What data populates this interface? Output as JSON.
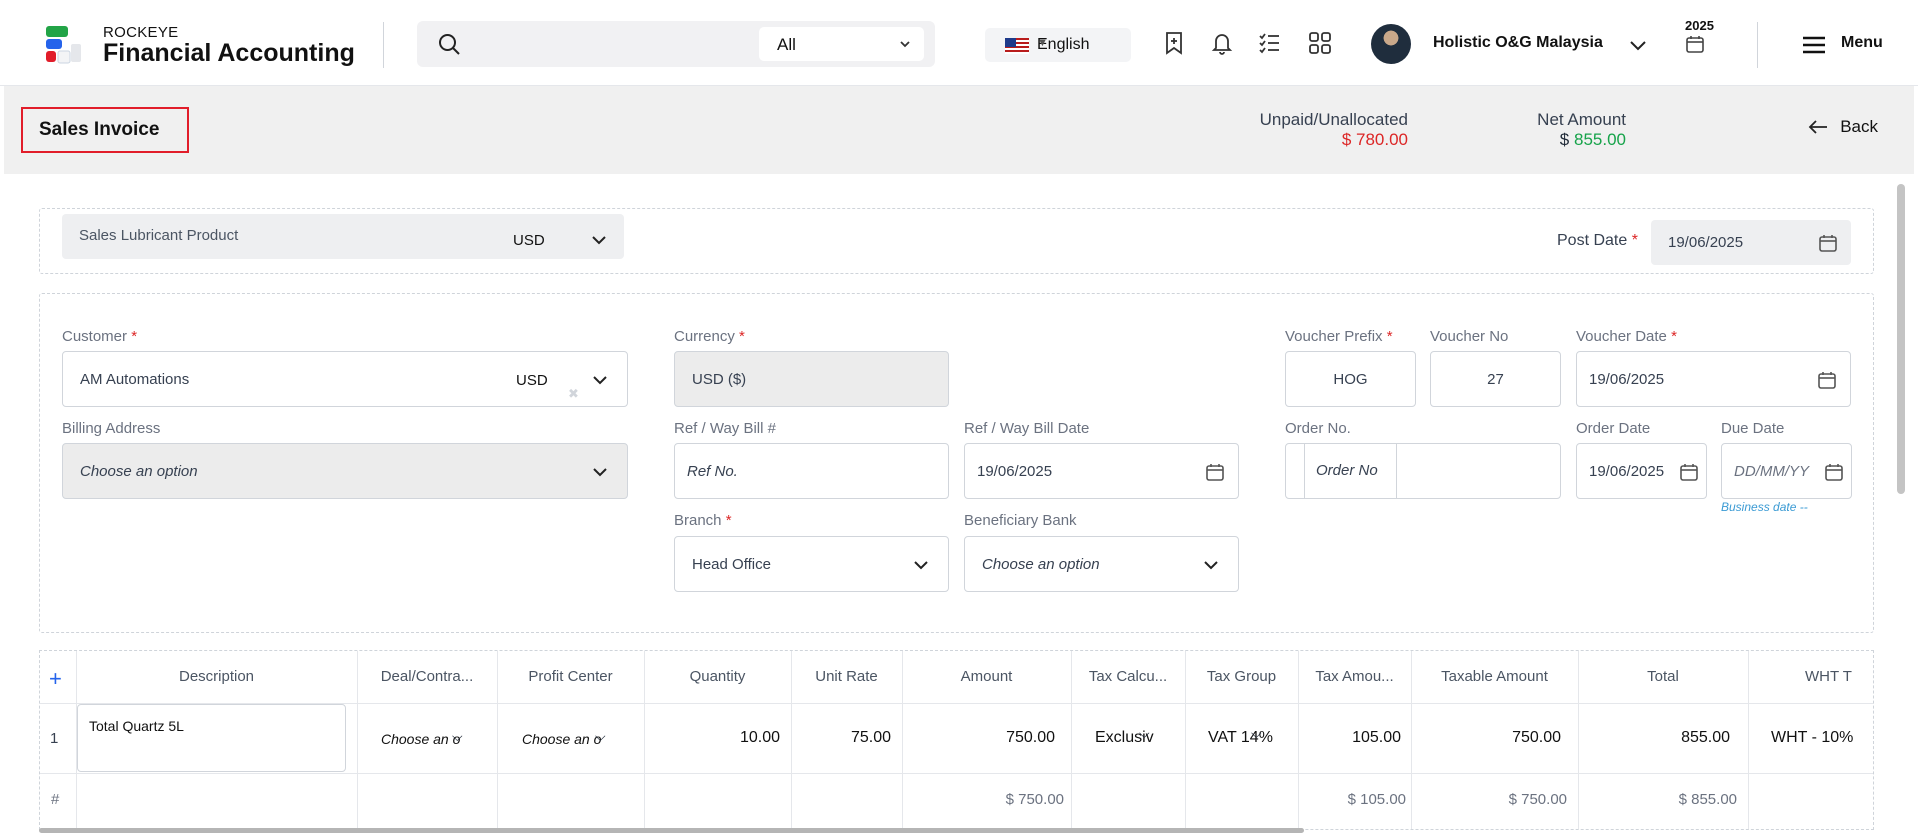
{
  "app": {
    "brand_small": "ROCKEYE",
    "brand_title": "Financial Accounting"
  },
  "topbar": {
    "search_scope": "All",
    "language": "English",
    "company": "Holistic O&G Malaysia",
    "year": "2025",
    "menu_label": "Menu",
    "icons": [
      "search-icon",
      "add-bookmark-icon",
      "bell-icon",
      "checklist-icon",
      "apps-grid-icon",
      "calendar-icon",
      "hamburger-icon"
    ]
  },
  "page": {
    "title": "Sales Invoice",
    "unpaid_label": "Unpaid/Unallocated",
    "unpaid_value": "$ 780.00",
    "net_label": "Net Amount",
    "net_currency": "$",
    "net_value": "855.00",
    "back_label": "Back",
    "colors": {
      "unpaid": "#dc2626",
      "net": "#16a34a",
      "highlight": "#e11d2a"
    }
  },
  "header_form": {
    "template": "Sales Lubricant Product",
    "template_currency": "USD",
    "post_date_label": "Post Date",
    "post_date": "19/06/2025"
  },
  "form": {
    "customer_label": "Customer",
    "customer": "AM Automations",
    "customer_currency": "USD",
    "currency_label": "Currency",
    "currency": "USD ($)",
    "voucher_prefix_label": "Voucher Prefix",
    "voucher_prefix": "HOG",
    "voucher_no_label": "Voucher No",
    "voucher_no": "27",
    "voucher_date_label": "Voucher Date",
    "voucher_date": "19/06/2025",
    "billing_label": "Billing Address",
    "billing_placeholder": "Choose an option",
    "ref_label": "Ref / Way Bill #",
    "ref_placeholder": "Ref No.",
    "ref_date_label": "Ref / Way Bill Date",
    "ref_date": "19/06/2025",
    "order_no_label": "Order No.",
    "order_no_placeholder": "Order No",
    "order_date_label": "Order Date",
    "order_date": "19/06/2025",
    "due_date_label": "Due Date",
    "due_date_placeholder": "DD/MM/YY",
    "business_date_note": "Business date --",
    "branch_label": "Branch",
    "branch": "Head Office",
    "bank_label": "Beneficiary Bank",
    "bank_placeholder": "Choose an option"
  },
  "grid": {
    "headers": [
      "Description",
      "Deal/Contra...",
      "Profit Center",
      "Quantity",
      "Unit Rate",
      "Amount",
      "Tax Calcu...",
      "Tax Group",
      "Tax Amou...",
      "Taxable Amount",
      "Total",
      "WHT T"
    ],
    "row": {
      "index": "1",
      "description": "Total Quartz 5L",
      "deal": "Choose an o",
      "profit_center": "Choose an o",
      "quantity": "10.00",
      "unit_rate": "75.00",
      "amount": "750.00",
      "tax_calc": "Exclusiv",
      "tax_group": "VAT 14%",
      "tax_amount": "105.00",
      "taxable_amount": "750.00",
      "total": "855.00",
      "wht": "WHT - 10%"
    },
    "totals": {
      "symbol": "#",
      "amount": "$ 750.00",
      "tax_amount": "$ 105.00",
      "taxable_amount": "$ 750.00",
      "total": "$ 855.00"
    }
  }
}
